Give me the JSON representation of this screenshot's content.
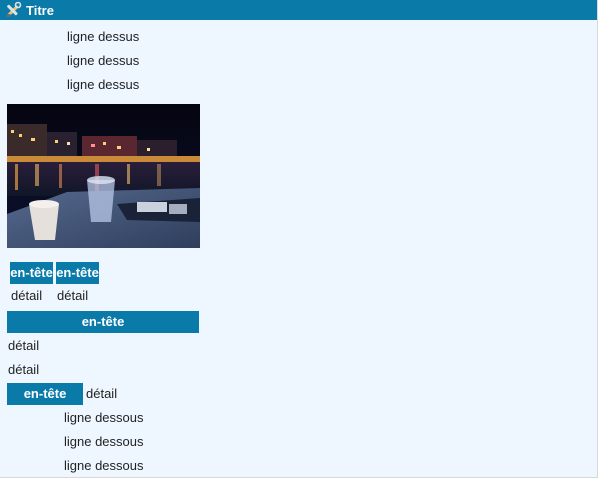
{
  "window": {
    "title": "Titre",
    "icon": "tools-icon"
  },
  "lines_above": [
    "ligne dessus",
    "ligne dessus",
    "ligne dessus"
  ],
  "image": {
    "description_icon": "harbor-night-photo"
  },
  "table1": {
    "headers": [
      "en-tête",
      "en-tête"
    ],
    "cells": [
      "détail",
      "détail"
    ]
  },
  "table2": {
    "header": "en-tête",
    "cells": [
      "détail",
      "détail"
    ]
  },
  "table3": {
    "header": "en-tête",
    "cell": "détail"
  },
  "lines_below": [
    "ligne dessous",
    "ligne dessous",
    "ligne dessous"
  ],
  "colors": {
    "accent": "#0a7aa9",
    "background": "#eef7ff"
  }
}
